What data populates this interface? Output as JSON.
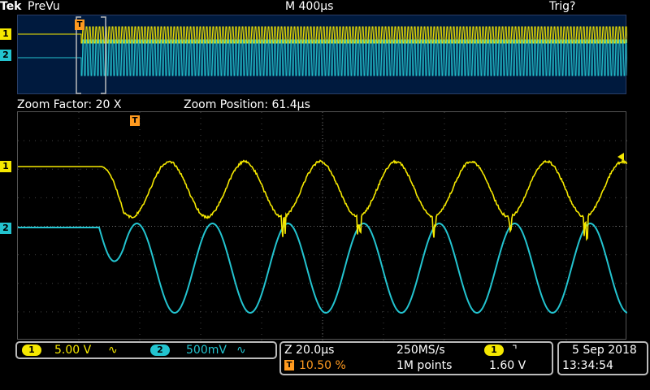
{
  "header": {
    "brand": "Tek",
    "mode": "PreVu",
    "timebase": "M 400µs",
    "trigger_status": "Trig?"
  },
  "zoom": {
    "factor": "Zoom Factor: 20 X",
    "position": "Zoom Position: 61.4µs"
  },
  "channels": [
    {
      "id": "1",
      "scale": "5.00 V",
      "coupling_symbol": "∿",
      "color": "#f5e800"
    },
    {
      "id": "2",
      "scale": "500mV",
      "coupling_symbol": "∿",
      "color": "#23c4d0"
    }
  ],
  "horizontal": {
    "zoom_scale": "Z 20.0µs",
    "trigger_position": "10.50 %",
    "trigger_icon": "T",
    "sample_rate": "250MS/s",
    "record_length": "1M points",
    "trigger_source": "1",
    "trigger_slope_symbol": "⌝",
    "trigger_level": "1.60 V"
  },
  "datetime": {
    "date": "5 Sep  2018",
    "time": "13:34:54"
  },
  "colors": {
    "ch1": "#f5e800",
    "ch2": "#23c4d0",
    "trigger": "#ff9a1f"
  }
}
